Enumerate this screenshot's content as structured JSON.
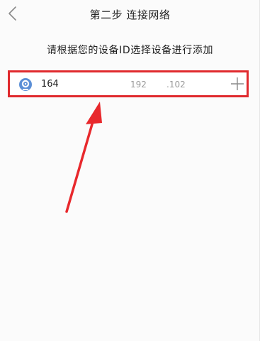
{
  "header": {
    "title": "第二步 连接网络",
    "back_icon": "chevron-left-icon"
  },
  "instruction": "请根据您的设备ID选择设备进行添加",
  "device": {
    "id": "164",
    "ip_prefix": "192",
    "ip_suffix": ".102",
    "icon": "camera-icon",
    "add_icon": "plus-icon"
  },
  "colors": {
    "highlight": "#e02a2e",
    "camera_icon": "#5b8fd6",
    "muted_text": "#9a9a9a"
  }
}
